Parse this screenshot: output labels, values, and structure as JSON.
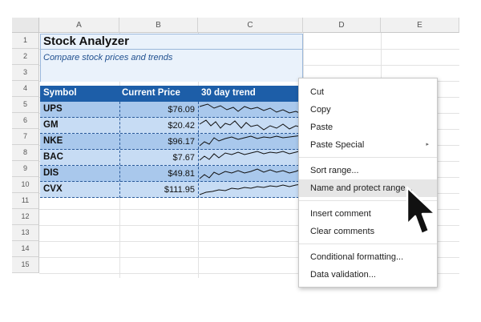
{
  "columns": [
    "A",
    "B",
    "C",
    "D",
    "E"
  ],
  "rows": [
    "1",
    "2",
    "3",
    "4",
    "5",
    "6",
    "7",
    "8",
    "9",
    "10",
    "11",
    "12",
    "13",
    "14",
    "15"
  ],
  "title": "Stock Analyzer",
  "subtitle": "Compare stock prices and trends",
  "table": {
    "headers": [
      "Symbol",
      "Current Price",
      "30 day trend"
    ],
    "rows": [
      {
        "symbol": "UPS",
        "price": "$76.09"
      },
      {
        "symbol": "GM",
        "price": "$20.42"
      },
      {
        "symbol": "NKE",
        "price": "$96.17"
      },
      {
        "symbol": "BAC",
        "price": "$7.67"
      },
      {
        "symbol": "DIS",
        "price": "$49.81"
      },
      {
        "symbol": "CVX",
        "price": "$111.95"
      }
    ]
  },
  "context_menu": {
    "items": [
      {
        "label": "Cut"
      },
      {
        "label": "Copy"
      },
      {
        "label": "Paste"
      },
      {
        "label": "Paste Special",
        "submenu": true
      },
      {
        "label": "Sort range..."
      },
      {
        "label": "Name and protect range...",
        "highlighted": true
      },
      {
        "label": "Insert comment"
      },
      {
        "label": "Clear comments"
      },
      {
        "label": "Conditional formatting..."
      },
      {
        "label": "Data validation..."
      }
    ],
    "submenu_arrow": "▸"
  },
  "colors": {
    "header_blue": "#1d5ea8",
    "row_light": "#c7dcf4",
    "row_mid": "#a9c8ec"
  },
  "icons": {
    "cursor": "mouse-pointer-icon"
  }
}
